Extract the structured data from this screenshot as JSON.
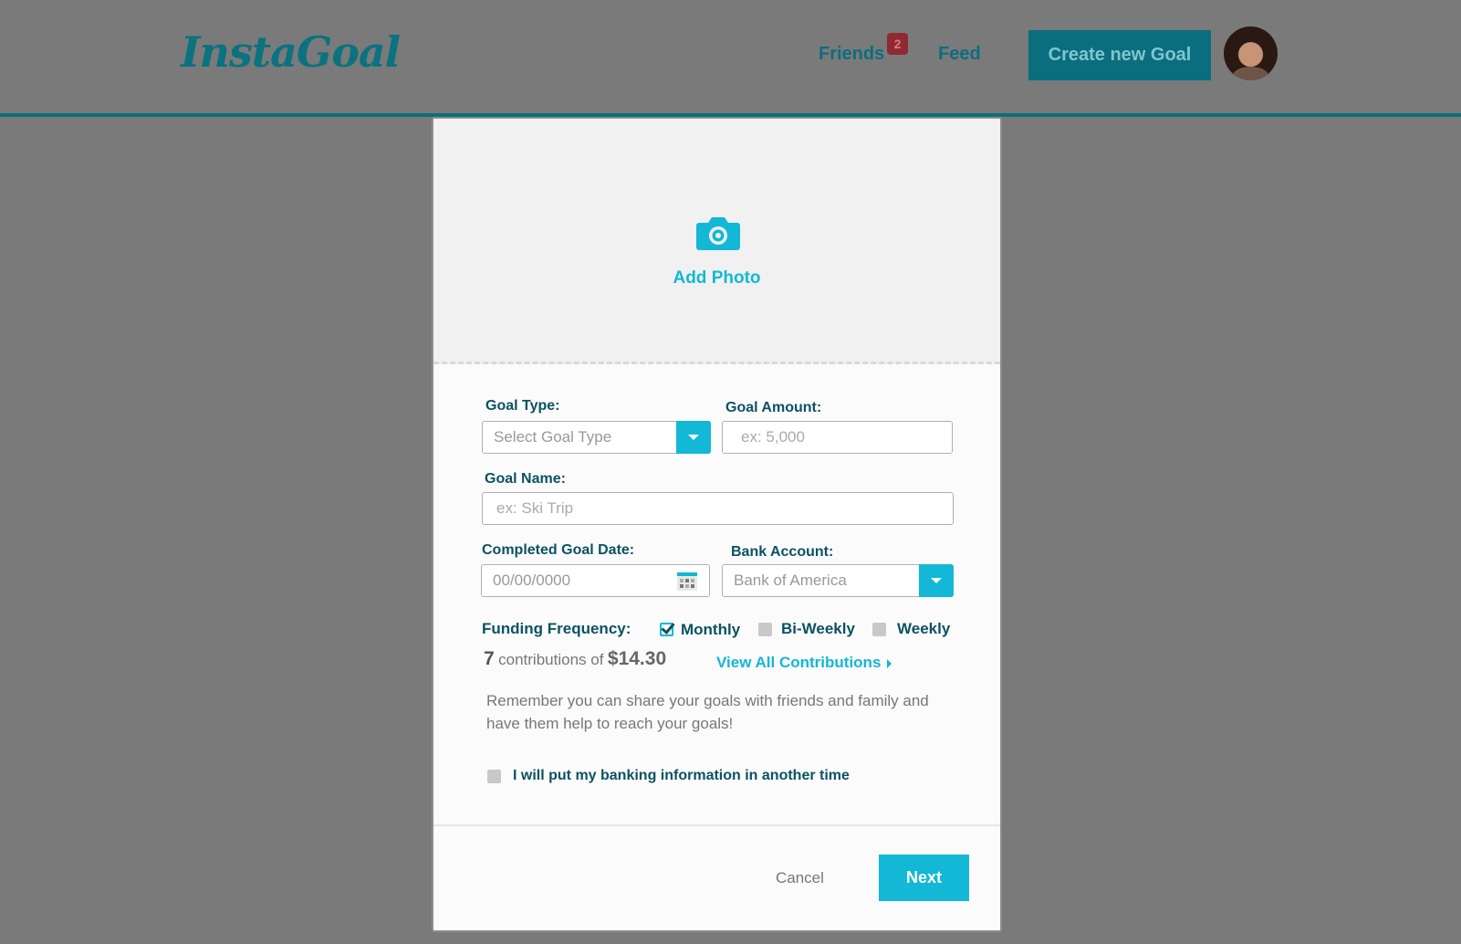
{
  "header": {
    "logo": "InstaGoal",
    "nav": {
      "friends": "Friends",
      "friends_badge": "2",
      "feed": "Feed"
    },
    "create_button": "Create new Goal"
  },
  "modal": {
    "photo": {
      "label": "Add Photo",
      "icon": "camera-icon"
    },
    "goal_type": {
      "label": "Goal Type:",
      "placeholder": "Select Goal Type"
    },
    "goal_amount": {
      "label": "Goal Amount:",
      "placeholder": "ex: 5,000"
    },
    "goal_name": {
      "label": "Goal Name:",
      "placeholder": "ex: Ski Trip"
    },
    "goal_date": {
      "label": "Completed Goal Date:",
      "placeholder": "00/00/0000"
    },
    "bank_account": {
      "label": "Bank Account:",
      "value": "Bank of America"
    },
    "funding": {
      "label": "Funding Frequency:",
      "options": [
        {
          "label": "Monthly",
          "checked": true
        },
        {
          "label": "Bi-Weekly",
          "checked": false
        },
        {
          "label": "Weekly",
          "checked": false
        }
      ]
    },
    "contributions": {
      "count": "7",
      "text": "contributions of",
      "amount": "$14.30",
      "view_all": "View All Contributions"
    },
    "reminder": "Remember you can share your goals with friends and family and have them help to reach your goals!",
    "banking_later": {
      "label": "I will put my banking information in another time",
      "checked": false
    },
    "cancel": "Cancel",
    "next": "Next"
  },
  "colors": {
    "accent": "#12b8d6",
    "brand_dark": "#0b6e7e",
    "overlay": "#7a7a7a"
  }
}
